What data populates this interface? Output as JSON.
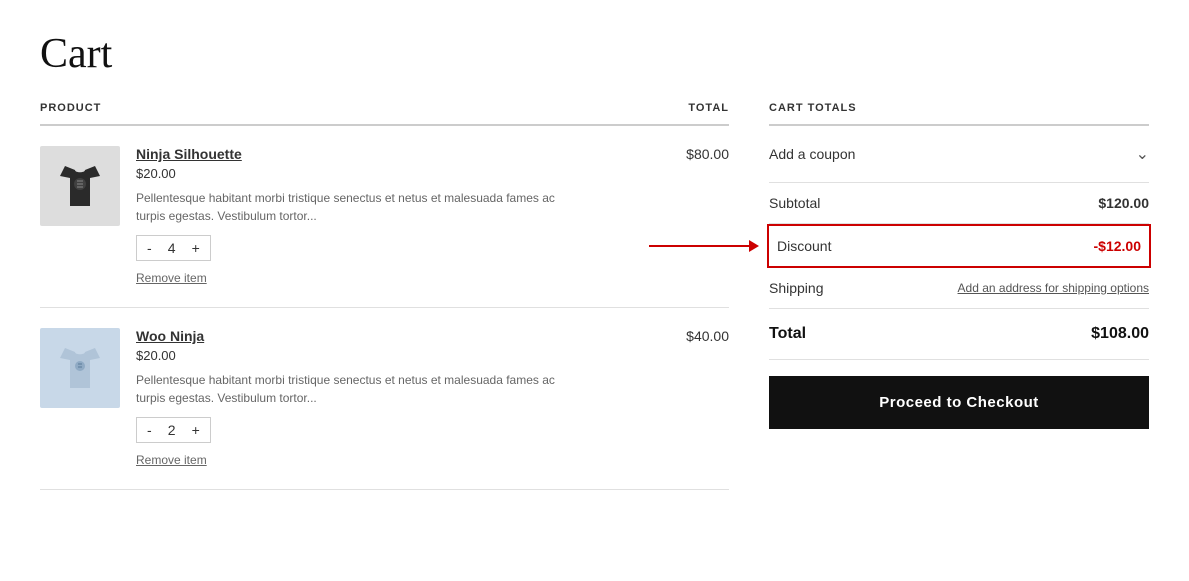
{
  "page": {
    "title": "Cart"
  },
  "table": {
    "col_product": "Product",
    "col_total": "Total"
  },
  "products": [
    {
      "id": "ninja-silhouette",
      "name": "Ninja Silhouette",
      "price": "$20.00",
      "total": "$80.00",
      "description": "Pellentesque habitant morbi tristique senectus et netus et malesuada fames ac turpis egestas. Vestibulum tortor...",
      "quantity": 4,
      "image_style": "dark",
      "remove_label": "Remove item"
    },
    {
      "id": "woo-ninja",
      "name": "Woo Ninja",
      "price": "$20.00",
      "total": "$40.00",
      "description": "Pellentesque habitant morbi tristique senectus et netus et malesuada fames ac turpis egestas. Vestibulum tortor...",
      "quantity": 2,
      "image_style": "light",
      "remove_label": "Remove item"
    }
  ],
  "cart_totals": {
    "title": "Cart Totals",
    "coupon_label": "Add a coupon",
    "subtotal_label": "Subtotal",
    "subtotal_value": "$120.00",
    "discount_label": "Discount",
    "discount_value": "-$12.00",
    "shipping_label": "Shipping",
    "shipping_link": "Add an address for shipping options",
    "total_label": "Total",
    "total_value": "$108.00",
    "checkout_label": "Proceed to Checkout"
  }
}
